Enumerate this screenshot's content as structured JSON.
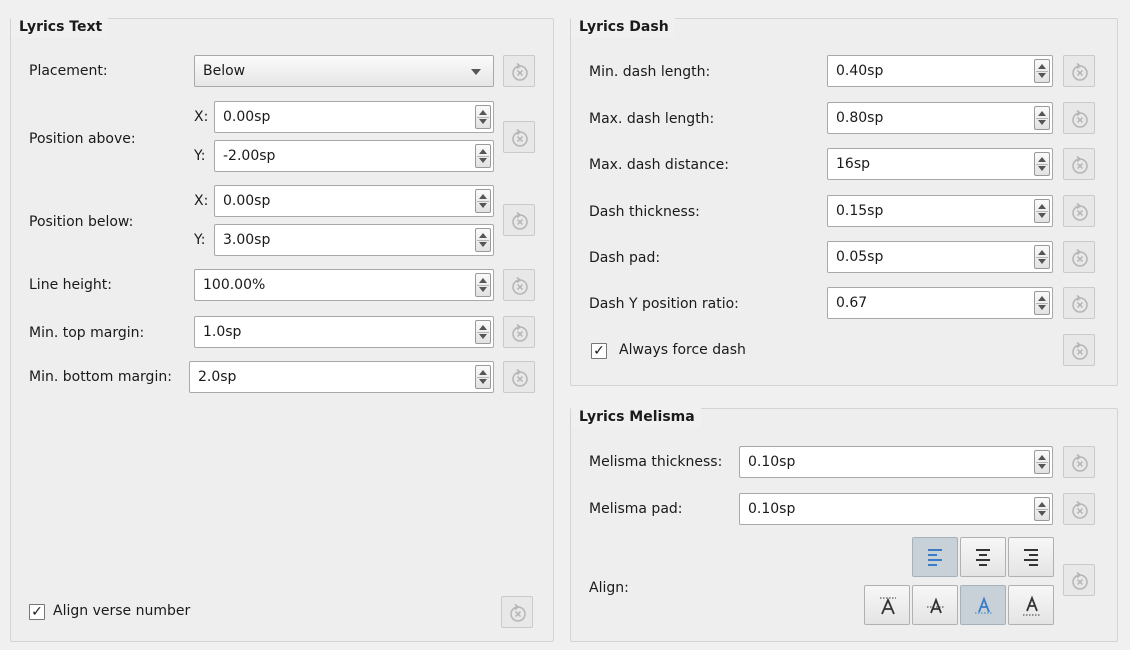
{
  "lyrics_text": {
    "title": "Lyrics Text",
    "placement_label": "Placement:",
    "placement_value": "Below",
    "position_above_label": "Position above:",
    "position_above_x": "0.00sp",
    "position_above_y": "-2.00sp",
    "position_below_label": "Position below:",
    "position_below_x": "0.00sp",
    "position_below_y": "3.00sp",
    "x_label": "X:",
    "y_label": "Y:",
    "line_height_label": "Line height:",
    "line_height_value": "100.00%",
    "min_top_margin_label": "Min. top margin:",
    "min_top_margin_value": "1.0sp",
    "min_bottom_margin_label": "Min. bottom margin:",
    "min_bottom_margin_value": "2.0sp",
    "align_verse_number_label": "Align verse number",
    "align_verse_number_checked": true
  },
  "lyrics_dash": {
    "title": "Lyrics Dash",
    "min_dash_length_label": "Min. dash length:",
    "min_dash_length_value": "0.40sp",
    "max_dash_length_label": "Max. dash length:",
    "max_dash_length_value": "0.80sp",
    "max_dash_distance_label": "Max. dash distance:",
    "max_dash_distance_value": "16sp",
    "dash_thickness_label": "Dash thickness:",
    "dash_thickness_value": "0.15sp",
    "dash_pad_label": "Dash pad:",
    "dash_pad_value": "0.05sp",
    "dash_y_ratio_label": "Dash Y position ratio:",
    "dash_y_ratio_value": "0.67",
    "always_force_dash_label": "Always force dash",
    "always_force_dash_checked": true
  },
  "lyrics_melisma": {
    "title": "Lyrics Melisma",
    "thickness_label": "Melisma thickness:",
    "thickness_value": "0.10sp",
    "pad_label": "Melisma pad:",
    "pad_value": "0.10sp",
    "align_label": "Align:",
    "horizontal_align_selected": "left",
    "vertical_align_selected": "baseline"
  },
  "check_glyph": "✓",
  "colors": {
    "accent": "#3a7cc6",
    "selected_button": "#c8d0d8",
    "panel_bg": "#f0f0f0"
  },
  "icons": {
    "reset": "reset-icon",
    "align_left": "align-left-icon",
    "align_center": "align-center-icon",
    "align_right": "align-right-icon",
    "valign_top": "align-top-icon",
    "valign_center": "align-vcenter-icon",
    "valign_baseline": "align-baseline-icon",
    "valign_bottom": "align-bottom-icon"
  }
}
